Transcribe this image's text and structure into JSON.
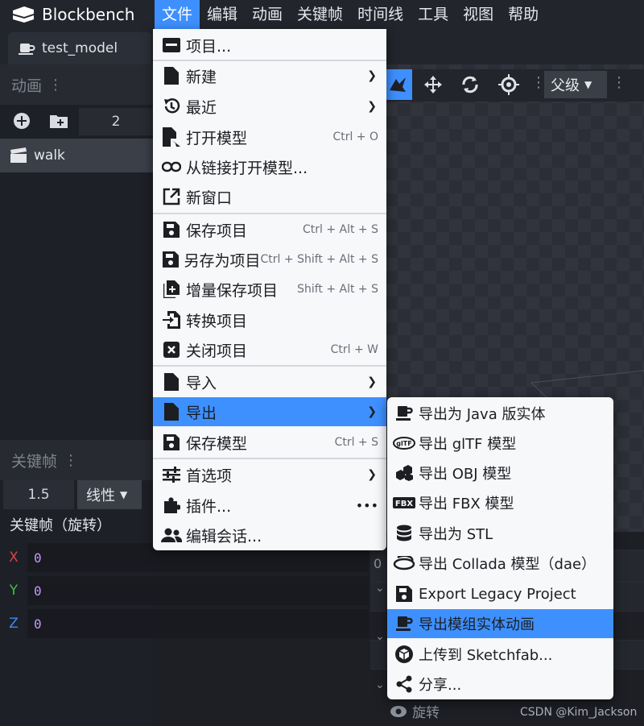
{
  "app": {
    "name": "Blockbench"
  },
  "menubar": {
    "items": [
      "文件",
      "编辑",
      "动画",
      "关键帧",
      "时间线",
      "工具",
      "视图",
      "帮助"
    ],
    "active": "文件"
  },
  "tab": {
    "label": "test_model"
  },
  "animations_panel": {
    "title": "动画",
    "count": "2",
    "items": [
      "walk"
    ]
  },
  "viewport_toolbar": {
    "parent_label": "父级"
  },
  "keyframe_panel": {
    "title": "关键帧",
    "time": "1.5",
    "interpolation": "线性",
    "heading": "关键帧（旋转）",
    "axes": [
      {
        "label": "X",
        "value": "0",
        "color": "#e04040"
      },
      {
        "label": "Y",
        "value": "0",
        "color": "#40c040"
      },
      {
        "label": "Z",
        "value": "0",
        "color": "#3a8df0"
      }
    ]
  },
  "timeline": {
    "zero": "0",
    "channel": "旋转"
  },
  "file_menu": {
    "items": [
      {
        "label": "项目...",
        "icon": "project-icon"
      },
      {
        "label": "新建",
        "icon": "file-icon",
        "submenu": true
      },
      {
        "label": "最近",
        "icon": "history-icon",
        "submenu": true
      },
      {
        "label": "打开模型",
        "icon": "open-icon",
        "shortcut": "Ctrl + O"
      },
      {
        "label": "从链接打开模型...",
        "icon": "link-icon"
      },
      {
        "label": "新窗口",
        "icon": "new-window-icon"
      },
      {
        "label": "保存项目",
        "icon": "save-icon",
        "shortcut": "Ctrl + Alt + S"
      },
      {
        "label": "另存为项目",
        "icon": "save-icon",
        "shortcut": "Ctrl + Shift + Alt + S"
      },
      {
        "label": "增量保存项目",
        "icon": "incremental-save-icon",
        "shortcut": "Shift + Alt + S"
      },
      {
        "label": "转换项目",
        "icon": "convert-icon"
      },
      {
        "label": "关闭项目",
        "icon": "close-icon",
        "shortcut": "Ctrl + W"
      },
      {
        "label": "导入",
        "icon": "file-icon",
        "submenu": true
      },
      {
        "label": "导出",
        "icon": "file-icon",
        "submenu": true,
        "highlighted": true
      },
      {
        "label": "保存模型",
        "icon": "save-icon",
        "shortcut": "Ctrl + S"
      },
      {
        "label": "首选项",
        "icon": "settings-sliders-icon",
        "submenu": true
      },
      {
        "label": "插件...",
        "icon": "plugin-icon",
        "extra": "•••"
      },
      {
        "label": "编辑会话...",
        "icon": "users-icon"
      }
    ]
  },
  "export_menu": {
    "items": [
      {
        "label": "导出为 Java 版实体",
        "icon": "java-cup-icon"
      },
      {
        "label": "导出 glTF 模型",
        "icon": "gltf-icon",
        "badge": "glTF"
      },
      {
        "label": "导出 OBJ 模型",
        "icon": "obj-icon"
      },
      {
        "label": "导出 FBX 模型",
        "icon": "fbx-icon",
        "badge": "FBX"
      },
      {
        "label": "导出为 STL",
        "icon": "database-icon"
      },
      {
        "label": "导出 Collada 模型（dae）",
        "icon": "collada-icon"
      },
      {
        "label": "Export Legacy Project",
        "icon": "save-icon"
      },
      {
        "label": "导出模组实体动画",
        "icon": "java-cup-icon",
        "highlighted": true
      },
      {
        "label": "上传到 Sketchfab...",
        "icon": "sketchfab-icon"
      },
      {
        "label": "分享...",
        "icon": "share-icon"
      }
    ]
  },
  "watermark": "CSDN @Kim_Jackson"
}
